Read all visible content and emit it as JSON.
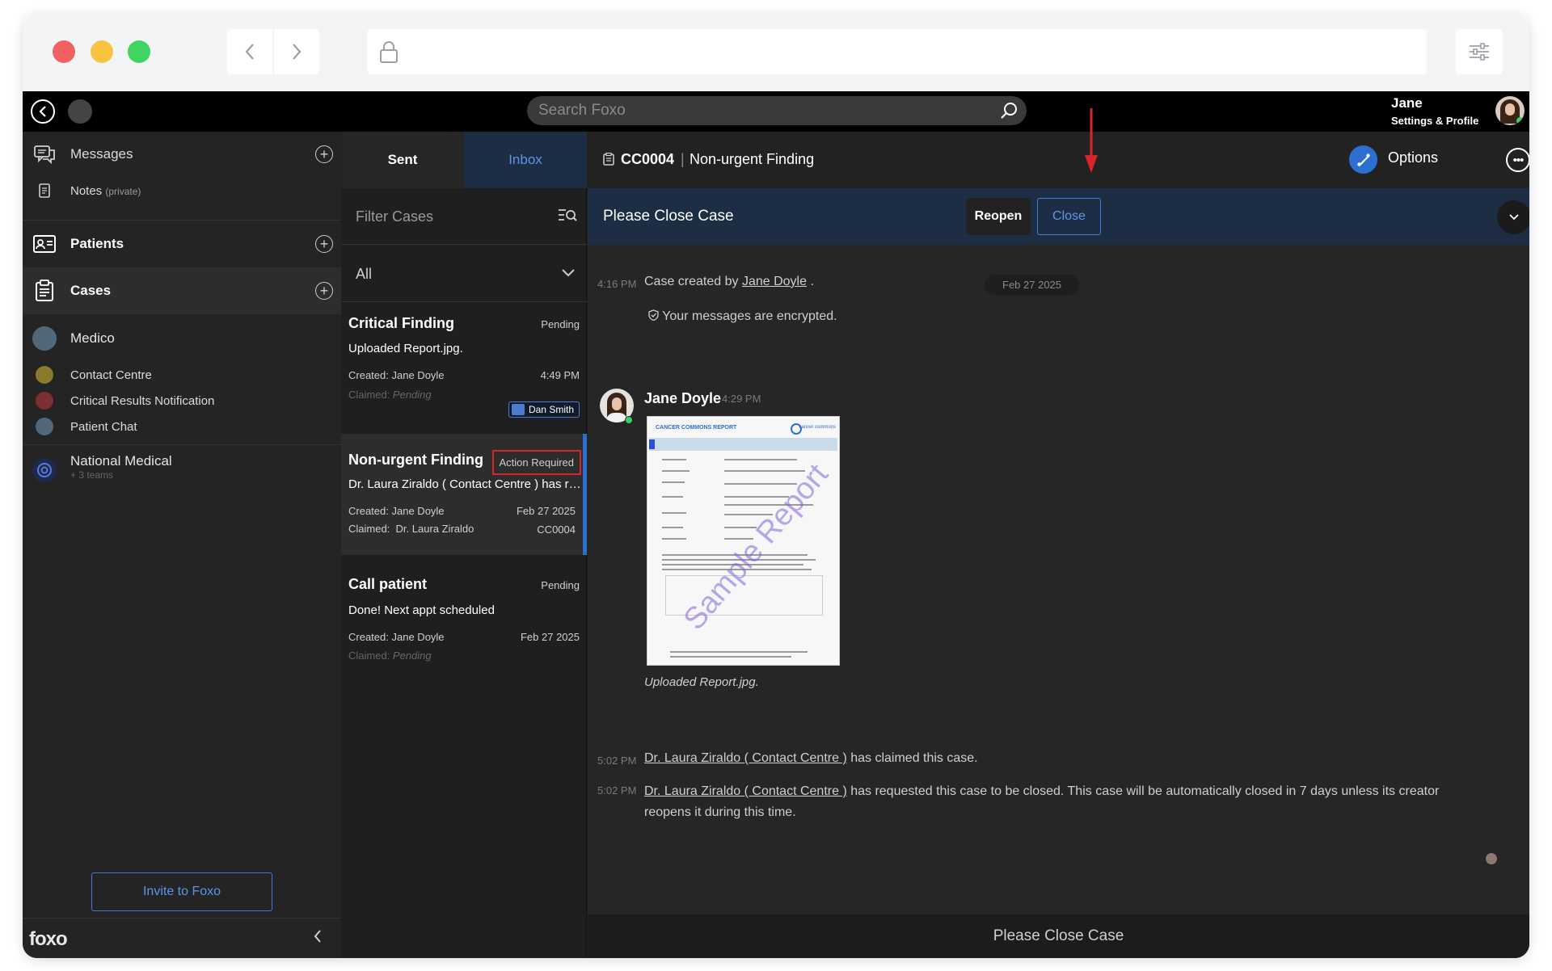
{
  "app": {
    "search_placeholder": "Search Foxo",
    "user_name": "Jane",
    "user_sub": "Settings & Profile"
  },
  "sidebar": {
    "messages": "Messages",
    "notes": "Notes",
    "notes_private": "(private)",
    "patients": "Patients",
    "cases": "Cases",
    "org1": "Medico",
    "teams": [
      {
        "label": "Contact Centre",
        "color": "#8a7a2a"
      },
      {
        "label": "Critical Results Notification",
        "color": "#7a3030"
      },
      {
        "label": "Patient Chat",
        "color": "#51687a"
      }
    ],
    "org2": "National Medical",
    "org2_sub": "+ 3 teams",
    "invite": "Invite to Foxo",
    "brand": "foxo"
  },
  "cases": {
    "tabs": {
      "sent": "Sent",
      "inbox": "Inbox"
    },
    "filter_placeholder": "Filter Cases",
    "filter_value": "All",
    "items": [
      {
        "title": "Critical Finding",
        "status": "Pending",
        "message": "Uploaded Report.jpg.",
        "created_label": "Created:",
        "created_by": "Jane Doyle",
        "time": "4:49 PM",
        "claimed_label": "Claimed:",
        "claimed": "Pending",
        "assignee": "Dan Smith"
      },
      {
        "title": "Non-urgent Finding",
        "status": "Action Required",
        "message": "Dr. Laura Ziraldo ( Contact Centre ) has requested this case to be closed.",
        "created_label": "Created:",
        "created_by": "Jane Doyle",
        "time": "Feb 27 2025",
        "claimed_label": "Claimed:",
        "claimed": "Dr. Laura Ziraldo",
        "case_id": "CC0004"
      },
      {
        "title": "Call patient",
        "status": "Pending",
        "message": "Done! Next appt scheduled",
        "created_label": "Created:",
        "created_by": "Jane Doyle",
        "time": "Feb 27 2025",
        "claimed_label": "Claimed:",
        "claimed": "Pending"
      }
    ]
  },
  "main": {
    "case_id": "CC0004",
    "separator": "|",
    "case_title": "Non-urgent Finding",
    "options": "Options",
    "banner_text": "Please Close Case",
    "reopen": "Reopen",
    "close": "Close",
    "date_pill": "Feb 27 2025",
    "events": [
      {
        "time": "4:16 PM",
        "pre": "Case created by ",
        "link": "Jane Doyle",
        "post": " ."
      }
    ],
    "encrypted": "Your messages are encrypted.",
    "message": {
      "sender": "Jane Doyle",
      "time": "4:29 PM",
      "report_header": "CANCER COMMONS REPORT",
      "report_logo": "cancer commons",
      "watermark": "Sample Report",
      "caption": "Uploaded Report.jpg."
    },
    "claim_event": {
      "time": "5:02 PM",
      "link": "Dr. Laura Ziraldo ( Contact Centre )",
      "post": " has claimed this case."
    },
    "request_event": {
      "time": "5:02 PM",
      "link": "Dr. Laura Ziraldo ( Contact Centre )",
      "post": " has requested this case to be closed. This case will be automatically closed in 7 days unless its creator",
      "line2": "reopens it during this time."
    },
    "footer": "Please Close Case"
  },
  "colors": {
    "accent": "#2b6fd1",
    "inbox_bg": "#1c2d44",
    "alert_red": "#d8242b",
    "online": "#3ad06a"
  }
}
